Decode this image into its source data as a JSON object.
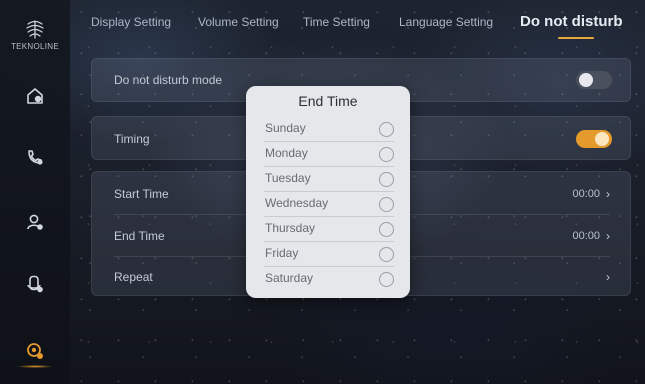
{
  "brand": {
    "logo_text": "TEKNOLINE"
  },
  "sidebar": {
    "items": [
      {
        "name": "home-settings-icon"
      },
      {
        "name": "phone-settings-icon"
      },
      {
        "name": "user-settings-icon"
      },
      {
        "name": "device-settings-icon"
      },
      {
        "name": "system-settings-icon",
        "active": true
      }
    ]
  },
  "tabs": [
    {
      "label": "Display Setting"
    },
    {
      "label": "Volume Setting"
    },
    {
      "label": "Time Setting"
    },
    {
      "label": "Language Setting"
    },
    {
      "label": "Do not disturb",
      "active": true
    }
  ],
  "settings": {
    "dnd_mode": {
      "label": "Do not disturb mode",
      "enabled": false
    },
    "timing": {
      "label": "Timing",
      "enabled": true
    },
    "start_time": {
      "label": "Start Time",
      "value": "00:00"
    },
    "end_time": {
      "label": "End Time",
      "value": "00:00"
    },
    "repeat": {
      "label": "Repeat",
      "value": ""
    }
  },
  "modal": {
    "title": "End Time",
    "days": [
      "Sunday",
      "Monday",
      "Tuesday",
      "Wednesday",
      "Thursday",
      "Friday",
      "Saturday"
    ]
  },
  "colors": {
    "accent": "#e59a2c",
    "modal_bg": "#e5e7ea",
    "card_bg": "rgba(120,130,150,0.20)"
  }
}
